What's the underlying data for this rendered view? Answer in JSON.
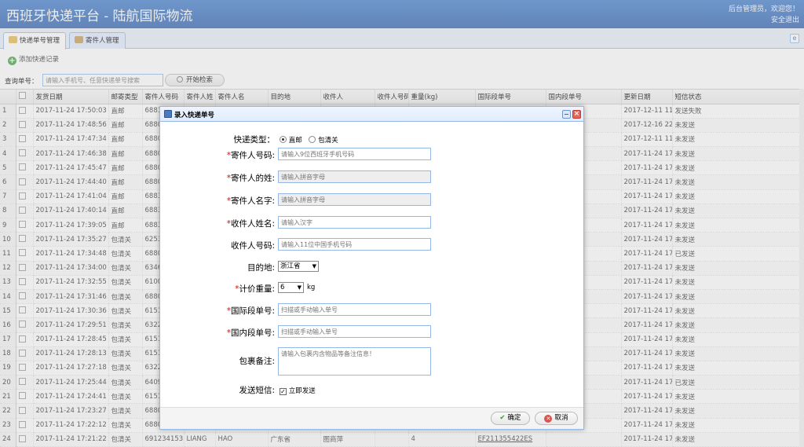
{
  "header": {
    "title": "西班牙快递平台 - 陆航国际物流",
    "welcome": "后台管理员，欢迎您！",
    "logout": "安全退出"
  },
  "tabs": [
    {
      "label": "快递单号管理",
      "icon": "package-icon",
      "active": true
    },
    {
      "label": "寄件人管理",
      "icon": "users-icon",
      "active": false
    }
  ],
  "toolbar": {
    "add_label": "添加快递记录"
  },
  "search": {
    "label": "查询单号：",
    "placeholder": "请输入手机号、任意快递单号搜索",
    "button": "开始检索"
  },
  "grid": {
    "columns": [
      "发货日期",
      "邮寄类型",
      "寄件人号码",
      "寄件人姓",
      "寄件人名",
      "目的地",
      "收件人",
      "收件人号码",
      "重量(kg)",
      "国际段单号",
      "国内段单号",
      "更新日期",
      "短信状态",
      "操作"
    ],
    "ops": [
      "重发",
      "编辑",
      "删除",
      "退包"
    ],
    "rows": [
      {
        "n": "1",
        "date": "2017-11-24 17:50:03",
        "type": "直邮",
        "phone": "6881",
        "upd": "2017-12-11 11:53:20",
        "sms": "发送失败"
      },
      {
        "n": "2",
        "date": "2017-11-24 17:48:56",
        "type": "直邮",
        "phone": "6880",
        "upd": "2017-12-16 22:10:55",
        "sms": "未发送"
      },
      {
        "n": "3",
        "date": "2017-11-24 17:47:34",
        "type": "直邮",
        "phone": "6880",
        "upd": "2017-12-11 11:53:30",
        "sms": "未发送"
      },
      {
        "n": "4",
        "date": "2017-11-24 17:46:38",
        "type": "直邮",
        "phone": "6880",
        "upd": "2017-11-24 17:46:38",
        "sms": "未发送"
      },
      {
        "n": "5",
        "date": "2017-11-24 17:45:47",
        "type": "直邮",
        "phone": "6880",
        "upd": "2017-11-24 17:45:47",
        "sms": "未发送"
      },
      {
        "n": "6",
        "date": "2017-11-24 17:44:40",
        "type": "直邮",
        "phone": "6880",
        "upd": "2017-11-24 17:44:40",
        "sms": "未发送"
      },
      {
        "n": "7",
        "date": "2017-11-24 17:41:04",
        "type": "直邮",
        "phone": "6883",
        "upd": "2017-11-24 17:41:04",
        "sms": "未发送"
      },
      {
        "n": "8",
        "date": "2017-11-24 17:40:14",
        "type": "直邮",
        "phone": "6883",
        "upd": "2017-11-24 17:40:14",
        "sms": "未发送"
      },
      {
        "n": "9",
        "date": "2017-11-24 17:39:05",
        "type": "直邮",
        "phone": "6883",
        "upd": "2017-11-24 17:39:05",
        "sms": "未发送"
      },
      {
        "n": "10",
        "date": "2017-11-24 17:35:27",
        "type": "包清关",
        "phone": "6253",
        "upd": "2017-11-24 17:35:27",
        "sms": "未发送"
      },
      {
        "n": "11",
        "date": "2017-11-24 17:34:48",
        "type": "包清关",
        "phone": "6880",
        "upd": "2017-11-24 17:34:48",
        "sms": "已发送"
      },
      {
        "n": "12",
        "date": "2017-11-24 17:34:00",
        "type": "包清关",
        "phone": "6346",
        "upd": "2017-11-24 17:34:00",
        "sms": "未发送"
      },
      {
        "n": "13",
        "date": "2017-11-24 17:32:55",
        "type": "包清关",
        "phone": "6100",
        "upd": "2017-11-24 17:32:55",
        "sms": "未发送"
      },
      {
        "n": "14",
        "date": "2017-11-24 17:31:46",
        "type": "包清关",
        "phone": "6880",
        "upd": "2017-11-24 17:31:46",
        "sms": "未发送"
      },
      {
        "n": "15",
        "date": "2017-11-24 17:30:36",
        "type": "包清关",
        "phone": "6151",
        "upd": "2017-11-24 17:30:36",
        "sms": "未发送"
      },
      {
        "n": "16",
        "date": "2017-11-24 17:29:51",
        "type": "包清关",
        "phone": "6322",
        "upd": "2017-11-24 17:29:51",
        "sms": "未发送"
      },
      {
        "n": "17",
        "date": "2017-11-24 17:28:45",
        "type": "包清关",
        "phone": "6151",
        "upd": "2017-11-24 17:28:45",
        "sms": "未发送"
      },
      {
        "n": "18",
        "date": "2017-11-24 17:28:13",
        "type": "包清关",
        "phone": "6151",
        "upd": "2017-11-24 17:28:13",
        "sms": "未发送"
      },
      {
        "n": "19",
        "date": "2017-11-24 17:27:18",
        "type": "包清关",
        "phone": "6322",
        "upd": "2017-11-24 17:27:18",
        "sms": "未发送"
      },
      {
        "n": "20",
        "date": "2017-11-24 17:25:44",
        "type": "包清关",
        "phone": "6409",
        "upd": "2017-11-24 17:25:45",
        "sms": "已发送"
      },
      {
        "n": "21",
        "date": "2017-11-24 17:24:41",
        "type": "包清关",
        "phone": "6151",
        "upd": "2017-11-24 17:24:41",
        "sms": "未发送"
      },
      {
        "n": "22",
        "date": "2017-11-24 17:23:27",
        "type": "包清关",
        "phone": "6880",
        "upd": "2017-11-24 17:23:27",
        "sms": "未发送"
      },
      {
        "n": "23",
        "date": "2017-11-24 17:22:12",
        "type": "包清关",
        "phone": "6880",
        "upd": "2017-11-24 17:22:12",
        "sms": "未发送"
      },
      {
        "n": "24",
        "date": "2017-11-24 17:21:22",
        "type": "包清关",
        "phone": "691234153",
        "last": "LIANG",
        "first": "HAO",
        "dest": "广东省",
        "recv": "图商萍",
        "weight": "4",
        "intl": "EF211355422ES",
        "upd": "2017-11-24 17:21:23",
        "sms": "未发送"
      }
    ]
  },
  "dialog": {
    "title": "录入快递单号",
    "type_label": "快递类型：",
    "type_options": [
      "直邮",
      "包清关"
    ],
    "sender_phone_label": "寄件人号码:",
    "sender_phone_ph": "请输入9位西班牙手机号码",
    "sender_last_label": "寄件人的姓:",
    "sender_last_ph": "请输入拼音字母",
    "sender_first_label": "寄件人名字:",
    "sender_first_ph": "请输入拼音字母",
    "recv_name_label": "收件人姓名:",
    "recv_name_ph": "请输入汉字",
    "recv_phone_label": "收件人号码:",
    "recv_phone_ph": "请输入11位中国手机号码",
    "dest_label": "目的地:",
    "dest_value": "浙江省",
    "weight_label": "计价重量:",
    "weight_value": "6",
    "weight_unit": "kg",
    "intl_label": "国际段单号:",
    "intl_ph": "扫描或手动输入单号",
    "dom_label": "国内段单号:",
    "dom_ph": "扫描或手动输入单号",
    "note_label": "包裹备注:",
    "note_ph": "请输入包裹内含物品等备注信息！",
    "sms_label": "发送短信:",
    "sms_check": "立即发送",
    "ok": "确定",
    "cancel": "取消"
  },
  "colors": {
    "header": "#2b5fb0",
    "border": "#95b8e7",
    "required": "#ee0000"
  }
}
